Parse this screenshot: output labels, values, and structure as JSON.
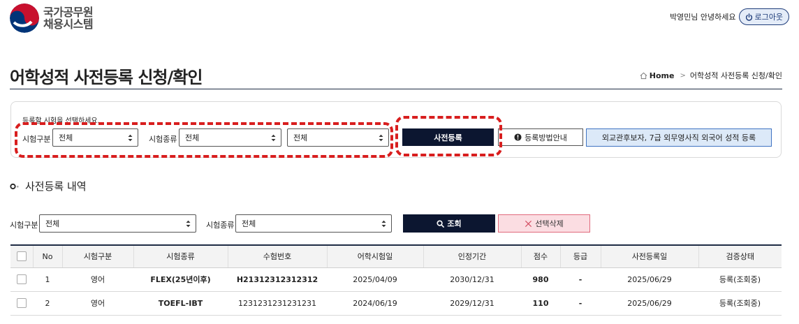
{
  "header": {
    "logo_line1": "국가공무원",
    "logo_line2": "채용시스템",
    "greeting": "박영민님 안녕하세요",
    "logout_label": "로그아웃"
  },
  "page": {
    "title": "어학성적 사전등록 신청/확인",
    "breadcrumb": [
      "Home",
      "어학성적 사전등록 신청/확인"
    ]
  },
  "registration": {
    "instruction": "등록할 시험을 선택하세요.",
    "exam_category_label": "시험구분",
    "exam_category_value": "전체",
    "exam_type_label": "시험종류",
    "exam_type_value": "전체",
    "exam_sub_value": "전체",
    "register_button": "사전등록",
    "guide_button": "등록방법안내",
    "diplomat_button": "외교관후보자, 7급 외무영사직 외국어 성적 등록"
  },
  "history": {
    "section_title": "사전등록 내역",
    "exam_category_label": "시험구분",
    "exam_category_value": "전체",
    "exam_type_label": "시험종류",
    "exam_type_value": "전체",
    "search_button": "조회",
    "delete_button": "선택삭제"
  },
  "table": {
    "headers": [
      "No",
      "시험구분",
      "시험종류",
      "수험번호",
      "어학시험일",
      "인정기간",
      "점수",
      "등급",
      "사전등록일",
      "검증상태"
    ],
    "rows": [
      [
        "1",
        "영어",
        "FLEX(25년이후)",
        "H21312312312312",
        "2025/04/09",
        "2030/12/31",
        "980",
        "-",
        "2025/06/29",
        "등록(조회중)"
      ],
      [
        "2",
        "영어",
        "TOEFL-IBT",
        "1231231231231231",
        "2024/06/19",
        "2029/12/31",
        "110",
        "-",
        "2025/06/29",
        "등록(조회중)"
      ]
    ]
  },
  "colors": {
    "navy": "#0c1630",
    "annotation_red": "#d81e1e",
    "logo_red": "#c8102e",
    "logo_blue": "#003478"
  }
}
